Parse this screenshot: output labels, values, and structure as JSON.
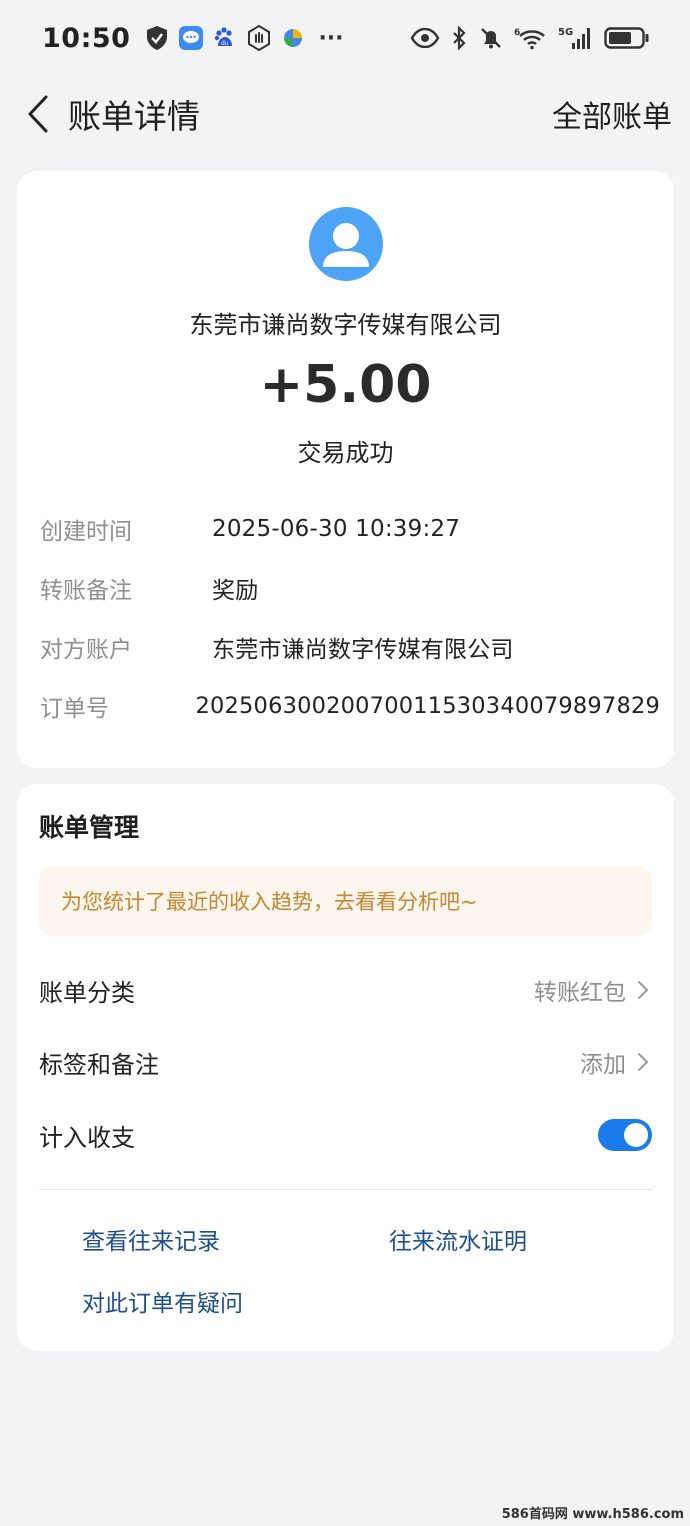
{
  "status_bar": {
    "time": "10:50",
    "left_icons": [
      "shield-icon",
      "message-icon",
      "baidu-paw-icon",
      "hand-stop-icon",
      "pinwheel-icon"
    ],
    "more": "···",
    "right_icons": [
      "eye-icon",
      "bluetooth-icon",
      "bell-muted-icon",
      "wifi-icon",
      "signal-5g-icon",
      "battery-icon"
    ],
    "network_label": "5G"
  },
  "header": {
    "title": "账单详情",
    "right_action": "全部账单"
  },
  "detail": {
    "merchant_name": "东莞市谦尚数字传媒有限公司",
    "amount": "+5.00",
    "status": "交易成功",
    "rows": [
      {
        "label": "创建时间",
        "value": "2025-06-30 10:39:27"
      },
      {
        "label": "转账备注",
        "value": "奖励"
      },
      {
        "label": "对方账户",
        "value": "东莞市谦尚数字传媒有限公司"
      },
      {
        "label": "订单号",
        "value": "20250630020070011530340079897829"
      }
    ]
  },
  "manage": {
    "title": "账单管理",
    "tip": "为您统计了最近的收入趋势，去看看分析吧~",
    "category": {
      "label": "账单分类",
      "value": "转账红包"
    },
    "tags": {
      "label": "标签和备注",
      "value": "添加"
    },
    "include": {
      "label": "计入收支",
      "enabled": true
    },
    "links": {
      "history": "查看往来记录",
      "proof": "往来流水证明",
      "question": "对此订单有疑问"
    }
  },
  "watermark": "586首码网 www.h586.com",
  "colors": {
    "background": "#f3f3f5",
    "accent_blue": "#1c7bea",
    "avatar_blue": "#4da3f5",
    "link_blue": "#1e4f8d",
    "tip_text": "#c8862f",
    "tip_bg": "#fdf6ee"
  }
}
